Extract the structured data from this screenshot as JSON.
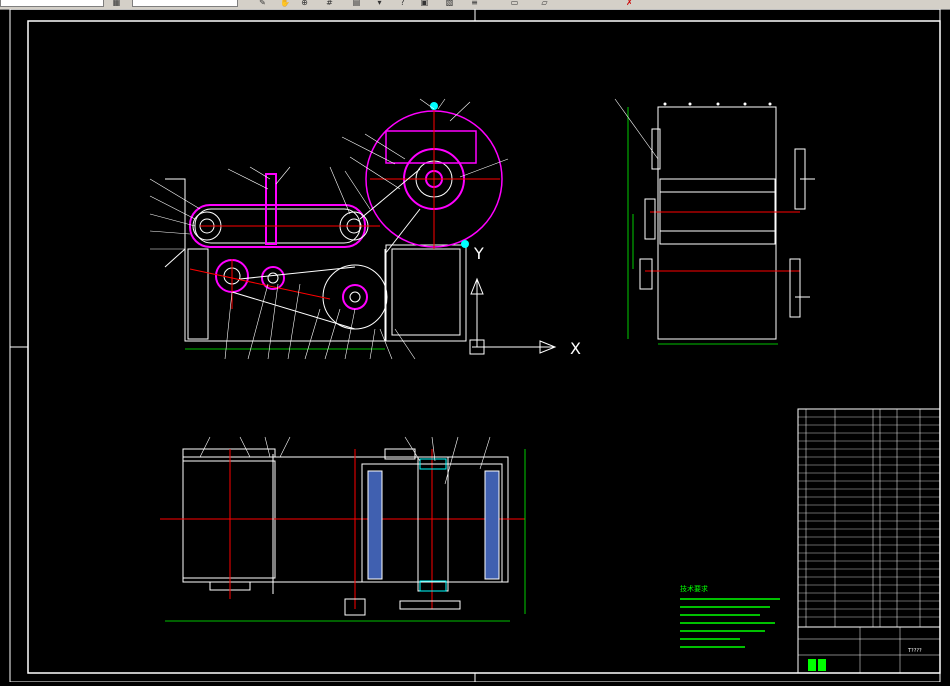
{
  "toolbar": {
    "icons": [
      "layer-icon",
      "draw-icon",
      "pan-icon",
      "zoom-icon",
      "grid-icon",
      "dropdown-icon",
      "help-icon",
      "properties-icon",
      "designcenter-icon",
      "toolpalette-icon",
      "calc-icon",
      "markup-icon",
      "quickcalc-icon",
      "close-icon"
    ]
  },
  "drawing": {
    "axis_x_label": "X",
    "axis_y_label": "Y",
    "colors": {
      "frame": "#ffffff",
      "part": "#ffffff",
      "magenta": "#ff00ff",
      "red": "#ff0000",
      "green": "#00ff00",
      "cyan": "#00ffff",
      "yellow": "#ffff00",
      "blue": "#4080ff"
    },
    "tech_notes_title": "技术要求",
    "title_block_text": "T????"
  }
}
